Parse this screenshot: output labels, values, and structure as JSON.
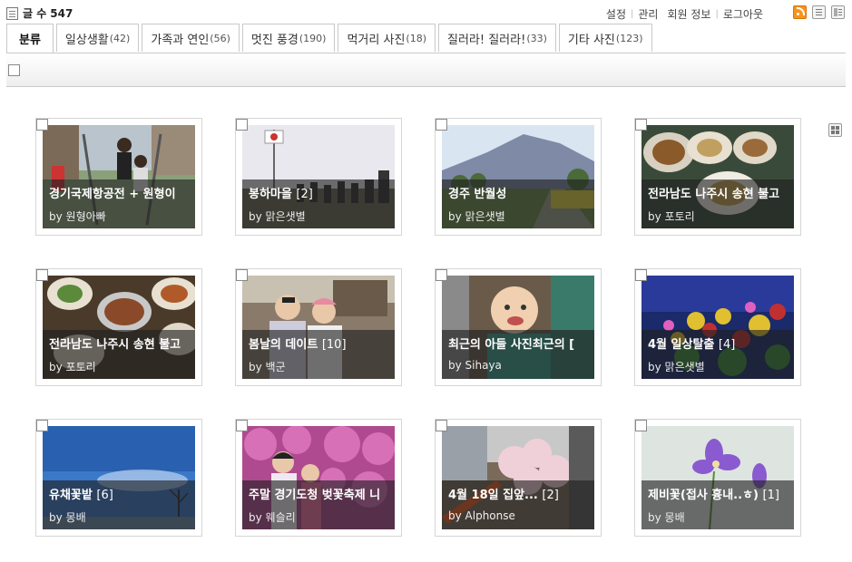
{
  "header": {
    "count_label": "글 수",
    "count_value": "547",
    "links": [
      "설정",
      "관리",
      "회원 정보",
      "로그아웃"
    ]
  },
  "view_icons": [
    "rss-icon",
    "list-view-icon",
    "detail-view-icon",
    "gallery-view-icon"
  ],
  "tabs": [
    {
      "label": "분류",
      "count": "",
      "active": true
    },
    {
      "label": "일상생활",
      "count": "(42)"
    },
    {
      "label": "가족과 연인",
      "count": "(56)"
    },
    {
      "label": "멋진 풍경",
      "count": "(190)"
    },
    {
      "label": "먹거리 사진",
      "count": "(18)"
    },
    {
      "label": "질러라! 질러라!",
      "count": "(33)"
    },
    {
      "label": "기타 사진",
      "count": "(123)"
    }
  ],
  "posts": [
    {
      "title": "경기국제항공전 + 원형이",
      "count": "",
      "by": "by 원형아빠",
      "scene": "playground"
    },
    {
      "title": "봉하마을",
      "count": "[2]",
      "by": "by 맑은샛별",
      "scene": "crowd"
    },
    {
      "title": "경주 반월성",
      "count": "",
      "by": "by 맑은샛별",
      "scene": "mountain"
    },
    {
      "title": "전라남도 나주시 송현 불고",
      "count": "",
      "by": "by 포토리",
      "scene": "food"
    },
    {
      "title": "전라남도 나주시 송현 불고",
      "count": "",
      "by": "by 포토리",
      "scene": "food2"
    },
    {
      "title": "봄날의 데이트",
      "count": "[10]",
      "by": "by 백군",
      "scene": "couple"
    },
    {
      "title": "최근의 아들 사진최근의 [",
      "count": "",
      "by": "by Sihaya",
      "scene": "baby"
    },
    {
      "title": "4월 일상탈출",
      "count": "[4]",
      "by": "by 맑은샛별",
      "scene": "flowers"
    },
    {
      "title": "유채꽃밭",
      "count": "[6]",
      "by": "by 몽배",
      "scene": "sky"
    },
    {
      "title": "주말 경기도청 벚꽃축제 니",
      "count": "",
      "by": "by 웨슬리",
      "scene": "azalea"
    },
    {
      "title": "4월 18일 집앞...",
      "count": "[2]",
      "by": "by Alphonse",
      "scene": "blossom"
    },
    {
      "title": "제비꽃(접사 흉내..ㅎ)",
      "count": "[1]",
      "by": "by 몽배",
      "scene": "violet"
    }
  ]
}
